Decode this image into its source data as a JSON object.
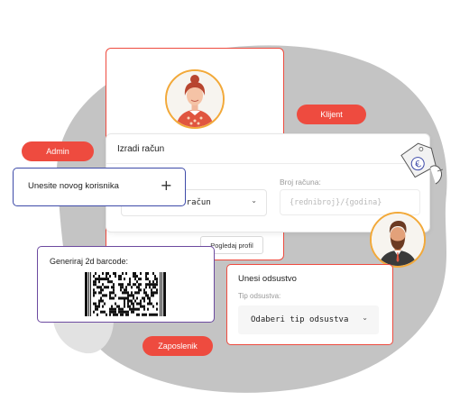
{
  "pills": {
    "klijent": "Klijent",
    "admin": "Admin",
    "zaposlenik": "Zaposlenik"
  },
  "invoice": {
    "title": "Izradi račun",
    "type_value": "jki račun",
    "number_label": "Broj računa:",
    "number_placeholder": "{rednibroj}/{godina}"
  },
  "profile": {
    "view_button": "Pogledaj profil"
  },
  "user": {
    "new_user_label": "Unesite novog korisnika",
    "add_symbol": "+"
  },
  "barcode": {
    "label": "Generiraj 2d barcode:"
  },
  "absence": {
    "title": "Unesi odsustvo",
    "type_label": "Tip odsustva:",
    "type_value": "Odaberi tip odsustva"
  },
  "colors": {
    "accent_red": "#ee4b3f",
    "admin_blue": "#3d4aa8",
    "barcode_purple": "#6c4aa0",
    "avatar_ring": "#f2a93a"
  }
}
